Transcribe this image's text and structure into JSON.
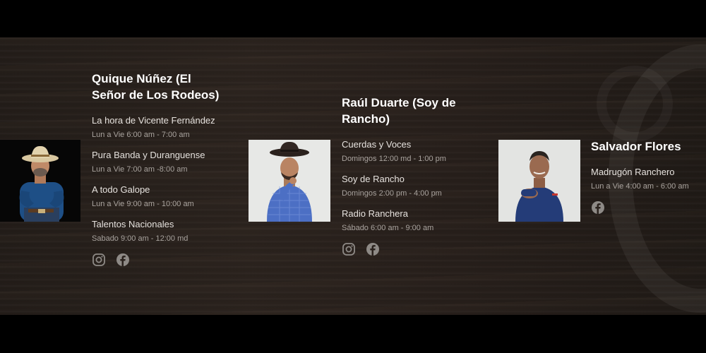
{
  "hosts": [
    {
      "name": "Quique Núñez (El Señor de Los Rodeos)",
      "shows": [
        {
          "title": "La hora de Vicente Fernández",
          "time": "Lun a Vie 6:00 am - 7:00 am"
        },
        {
          "title": "Pura Banda y Duranguense",
          "time": "Lun a Vie 7:00 am -8:00 am"
        },
        {
          "title": "A todo Galope",
          "time": "Lun a Vie 9:00 am - 10:00 am"
        },
        {
          "title": "Talentos Nacionales",
          "time": "Sabado 9:00 am - 12:00 md"
        }
      ],
      "social": [
        "instagram-icon",
        "facebook-icon"
      ]
    },
    {
      "name": "Raúl Duarte (Soy de Rancho)",
      "shows": [
        {
          "title": "Cuerdas y Voces",
          "time": "Domingos 12:00 md - 1:00 pm"
        },
        {
          "title": "Soy de Rancho",
          "time": "Domingos 2:00 pm - 4:00 pm"
        },
        {
          "title": "Radio Ranchera",
          "time": "Sábado 6:00 am - 9:00 am"
        }
      ],
      "social": [
        "instagram-icon",
        "facebook-icon"
      ]
    },
    {
      "name": "Salvador Flores",
      "shows": [
        {
          "title": "Madrugón Ranchero",
          "time": "Lun a Vie 4:00 am - 6:00 am"
        }
      ],
      "social": [
        "facebook-icon"
      ]
    }
  ],
  "colors": {
    "background": "#231d19",
    "name_text": "#ffffff",
    "show_text": "#e6e2de",
    "time_text": "#a9a39e",
    "icon": "#8e8a86"
  }
}
